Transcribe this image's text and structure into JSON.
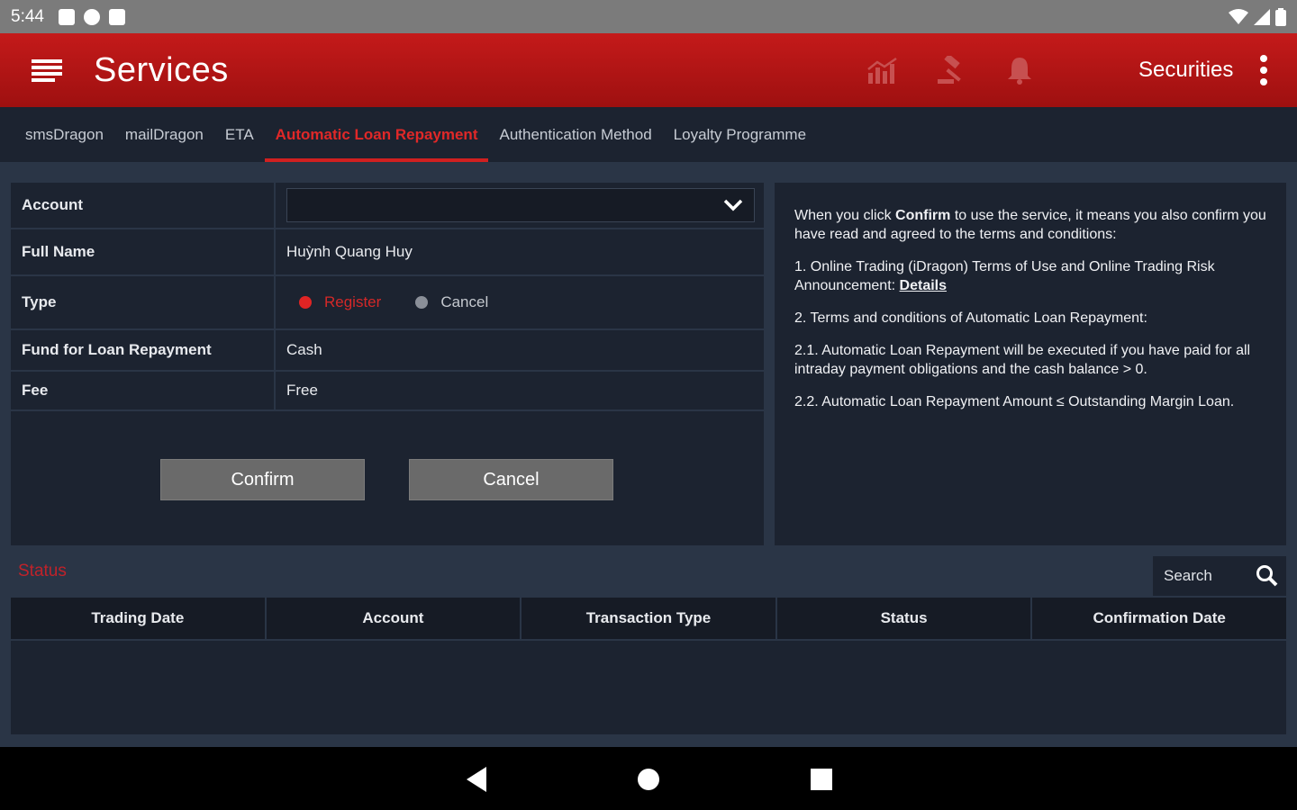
{
  "status_bar": {
    "time": "5:44"
  },
  "header": {
    "title": "Services",
    "account_type": "Securities"
  },
  "tabs": [
    {
      "label": "smsDragon"
    },
    {
      "label": "mailDragon"
    },
    {
      "label": "ETA"
    },
    {
      "label": "Automatic Loan Repayment",
      "active": true
    },
    {
      "label": "Authentication Method"
    },
    {
      "label": "Loyalty Programme"
    }
  ],
  "form": {
    "account_label": "Account",
    "account_value": "",
    "fullname_label": "Full Name",
    "fullname_value": "Huỳnh Quang Huy",
    "type_label": "Type",
    "type_options": [
      "Register",
      "Cancel"
    ],
    "type_selected": "Register",
    "fund_label": "Fund for Loan Repayment",
    "fund_value": "Cash",
    "fee_label": "Fee",
    "fee_value": "Free",
    "confirm_label": "Confirm",
    "cancel_label": "Cancel"
  },
  "terms": {
    "intro_a": "When you click ",
    "intro_b": "Confirm",
    "intro_c": " to use the service, it means you also confirm you have read and agreed to the terms and conditions:",
    "item1": "1. Online Trading (iDragon) Terms of Use and Online Trading Risk Announcement: ",
    "item1_link": "Details",
    "item2": "2. Terms and conditions of Automatic Loan Repayment:",
    "item21": "2.1. Automatic Loan Repayment will be executed if you have paid for all intraday payment obligations and the cash balance > 0.",
    "item22": "2.2. Automatic Loan Repayment Amount ≤ Outstanding Margin Loan."
  },
  "status_section": {
    "title": "Status",
    "search_label": "Search",
    "columns": [
      "Trading Date",
      "Account",
      "Transaction Type",
      "Status",
      "Confirmation Date"
    ]
  },
  "colors": {
    "brand_red": "#c41a1a",
    "panel": "#1c2330",
    "background": "#2a3546"
  }
}
